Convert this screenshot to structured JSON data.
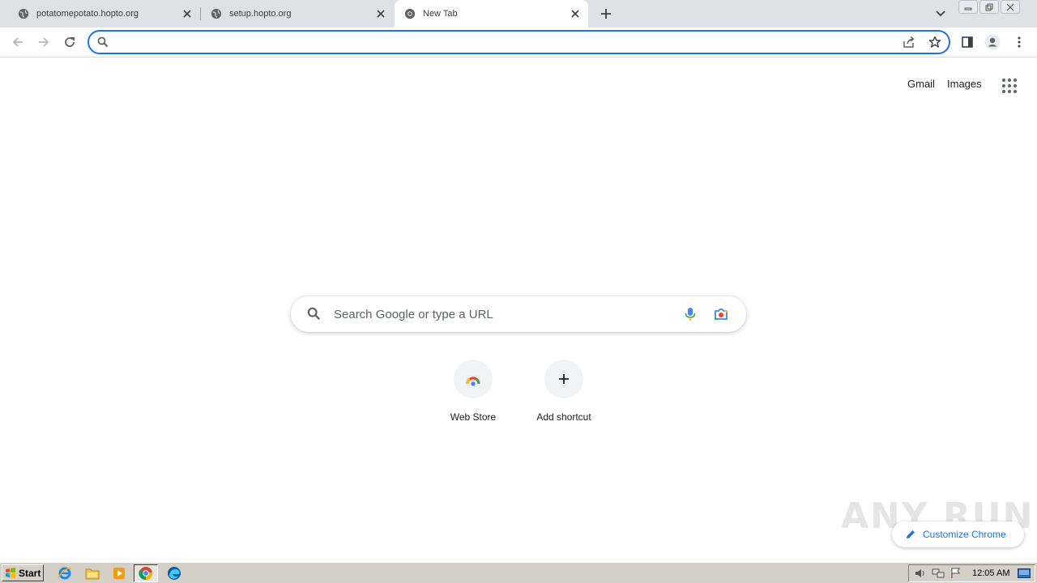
{
  "browser": {
    "tabs": [
      {
        "title": "potatomepotato.hopto.org",
        "active": false
      },
      {
        "title": "setup.hopto.org",
        "active": false
      },
      {
        "title": "New Tab",
        "active": true
      }
    ],
    "omnibox": {
      "value": "",
      "placeholder": ""
    }
  },
  "ntp": {
    "top_links": {
      "gmail": "Gmail",
      "images": "Images"
    },
    "search_placeholder": "Search Google or type a URL",
    "shortcuts": [
      {
        "label": "Web Store",
        "icon": "web-store-icon"
      },
      {
        "label": "Add shortcut",
        "icon": "plus-icon"
      }
    ],
    "customize_label": "Customize Chrome",
    "watermark": "ANY RUN"
  },
  "taskbar": {
    "start_label": "Start",
    "pinned": [
      "internet-explorer-icon",
      "file-explorer-icon",
      "media-player-icon",
      "chrome-icon",
      "edge-icon"
    ],
    "clock": "12:05 AM"
  },
  "colors": {
    "accent": "#1a73e8",
    "tabstrip": "#dee1e6",
    "taskbar": "#d4d0c8"
  }
}
